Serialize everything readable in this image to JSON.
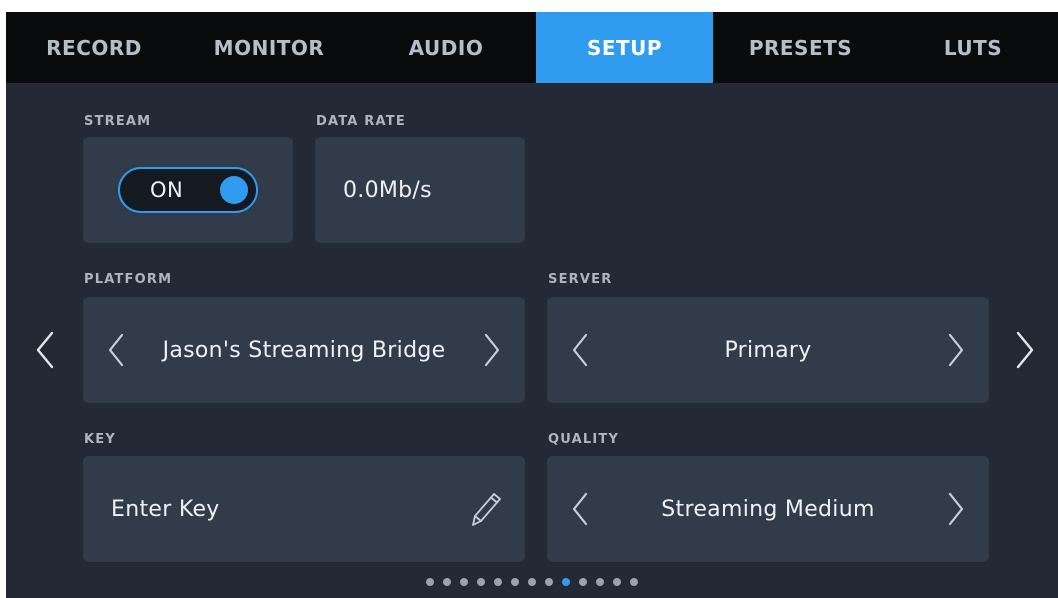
{
  "tabs": [
    {
      "label": "RECORD",
      "active": false
    },
    {
      "label": "MONITOR",
      "active": false
    },
    {
      "label": "AUDIO",
      "active": false
    },
    {
      "label": "SETUP",
      "active": true
    },
    {
      "label": "PRESETS",
      "active": false
    },
    {
      "label": "LUTS",
      "active": false
    }
  ],
  "stream": {
    "label": "STREAM",
    "toggle_text": "ON",
    "enabled": true
  },
  "data_rate": {
    "label": "DATA RATE",
    "value": "0.0Mb/s"
  },
  "platform": {
    "label": "PLATFORM",
    "value": "Jason's Streaming Bridge"
  },
  "server": {
    "label": "SERVER",
    "value": "Primary"
  },
  "key": {
    "label": "KEY",
    "placeholder": "Enter Key"
  },
  "quality": {
    "label": "QUALITY",
    "value": "Streaming Medium"
  },
  "pagination": {
    "total": 13,
    "current": 9
  },
  "colors": {
    "accent": "#2f9cf0",
    "background": "#232a35",
    "card": "#323b4a",
    "tabbar": "#0a0b0d"
  },
  "icons": {
    "prev_page": "chevron-left-icon",
    "next_page": "chevron-right-icon",
    "edit_key": "pencil-icon"
  }
}
